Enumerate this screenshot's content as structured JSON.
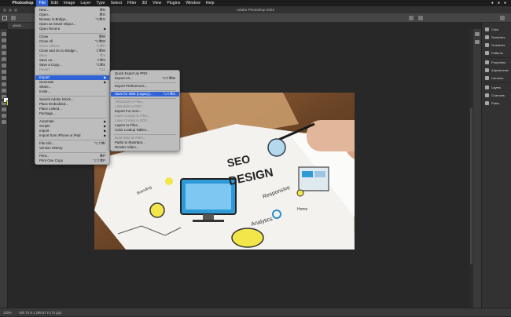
{
  "menubar": {
    "apple": "",
    "items": [
      "Photoshop",
      "File",
      "Edit",
      "Image",
      "Layer",
      "Type",
      "Select",
      "Filter",
      "3D",
      "View",
      "Plugins",
      "Window",
      "Help"
    ],
    "active_index": 1
  },
  "window": {
    "title": "Adobe Photoshop 2022"
  },
  "document": {
    "tab_label": "WHITI..."
  },
  "file_menu": {
    "groups": [
      [
        {
          "label": "New...",
          "shortcut": "⌘N"
        },
        {
          "label": "Open...",
          "shortcut": "⌘O"
        },
        {
          "label": "Browse in Bridge...",
          "shortcut": "⌥⌘O"
        },
        {
          "label": "Open as Smart Object...",
          "shortcut": ""
        },
        {
          "label": "Open Recent",
          "shortcut": "",
          "submenu": true
        }
      ],
      [
        {
          "label": "Close",
          "shortcut": "⌘W"
        },
        {
          "label": "Close All",
          "shortcut": "⌥⌘W"
        },
        {
          "label": "Close Others",
          "shortcut": "⌥⌘P",
          "disabled": true
        },
        {
          "label": "Close and Go to Bridge...",
          "shortcut": "⇧⌘W"
        },
        {
          "label": "Save",
          "shortcut": "⌘S",
          "disabled": true
        },
        {
          "label": "Save As...",
          "shortcut": "⇧⌘S"
        },
        {
          "label": "Save a Copy...",
          "shortcut": "⌥⌘S"
        },
        {
          "label": "Revert",
          "shortcut": "F12",
          "disabled": true
        }
      ],
      [
        {
          "label": "Export",
          "shortcut": "",
          "submenu": true,
          "highlighted": true
        },
        {
          "label": "Generate",
          "shortcut": "",
          "submenu": true
        },
        {
          "label": "Share...",
          "shortcut": ""
        },
        {
          "label": "Invite...",
          "shortcut": ""
        }
      ],
      [
        {
          "label": "Search Adobe Stock...",
          "shortcut": ""
        },
        {
          "label": "Place Embedded...",
          "shortcut": ""
        },
        {
          "label": "Place Linked...",
          "shortcut": ""
        },
        {
          "label": "Package...",
          "shortcut": ""
        }
      ],
      [
        {
          "label": "Automate",
          "shortcut": "",
          "submenu": true
        },
        {
          "label": "Scripts",
          "shortcut": "",
          "submenu": true
        },
        {
          "label": "Import",
          "shortcut": "",
          "submenu": true
        },
        {
          "label": "Import from iPhone or iPad",
          "shortcut": "",
          "submenu": true
        }
      ],
      [
        {
          "label": "File Info...",
          "shortcut": "⌥⇧⌘I"
        },
        {
          "label": "Version History",
          "shortcut": ""
        }
      ],
      [
        {
          "label": "Print...",
          "shortcut": "⌘P"
        },
        {
          "label": "Print One Copy",
          "shortcut": "⌥⇧⌘P"
        }
      ]
    ]
  },
  "export_menu": {
    "groups": [
      [
        {
          "label": "Quick Export as PNG",
          "shortcut": ""
        },
        {
          "label": "Export As...",
          "shortcut": "⌥⇧⌘W"
        }
      ],
      [
        {
          "label": "Export Preferences...",
          "shortcut": ""
        }
      ],
      [
        {
          "label": "Save for Web (Legacy)...",
          "shortcut": "⌥⇧⌘S",
          "highlighted": true
        }
      ],
      [
        {
          "label": "Artboards to Files...",
          "shortcut": "",
          "disabled": true
        },
        {
          "label": "Artboards to PDF...",
          "shortcut": "",
          "disabled": true
        },
        {
          "label": "Export For Aero...",
          "shortcut": ""
        },
        {
          "label": "Layer Comps to Files...",
          "shortcut": "",
          "disabled": true
        },
        {
          "label": "Layer Comps to PDF...",
          "shortcut": "",
          "disabled": true
        },
        {
          "label": "Layers to Files...",
          "shortcut": ""
        },
        {
          "label": "Color Lookup Tables...",
          "shortcut": ""
        }
      ],
      [
        {
          "label": "Data Sets as Files...",
          "shortcut": "",
          "disabled": true
        },
        {
          "label": "Paths to Illustrator...",
          "shortcut": ""
        },
        {
          "label": "Render Video...",
          "shortcut": ""
        }
      ]
    ]
  },
  "panels": {
    "items": [
      "Color",
      "Swatches",
      "Gradients",
      "Patterns",
      "Properties",
      "Adjustments",
      "Libraries",
      "Layers",
      "Channels",
      "Paths"
    ]
  },
  "status": {
    "zoom": "100%",
    "dims": "490.78 in x 299.87 in (72 ppi)"
  },
  "artwork": {
    "seo": "SEO",
    "design": "DESIGN",
    "responsive": "Responsive",
    "analytics": "Analytics",
    "branding": "Branding",
    "home": "Home"
  }
}
